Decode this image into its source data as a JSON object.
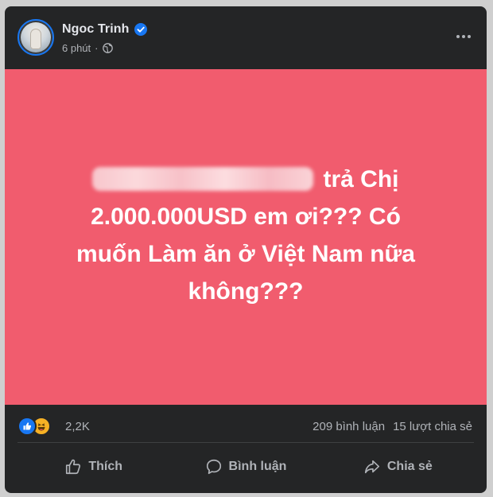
{
  "post": {
    "author": {
      "name": "Ngoc Trinh",
      "verified": true,
      "time": "6 phút",
      "separator": "·",
      "audience_icon": "globe-icon"
    },
    "more_icon": "more-horizontal-icon",
    "background_color": "#f15c6e",
    "text": {
      "redacted_prefix_icon": "blurred-text",
      "line1": "trả Chị",
      "line2": "2.000.000USD em ơi??? Có",
      "line3": "muốn Làm ăn ở Việt Nam nữa",
      "line4": "không???"
    }
  },
  "stats": {
    "reaction_icons": [
      "like-icon",
      "haha-icon"
    ],
    "reaction_count": "2,2K",
    "comments": "209 bình luận",
    "shares": "15 lượt chia sẻ"
  },
  "actions": {
    "like_label": "Thích",
    "comment_label": "Bình luận",
    "share_label": "Chia sẻ"
  },
  "colors": {
    "card_bg": "#242526",
    "text_primary": "#e4e6eb",
    "text_secondary": "#b0b3b8",
    "accent": "#1877f2"
  }
}
